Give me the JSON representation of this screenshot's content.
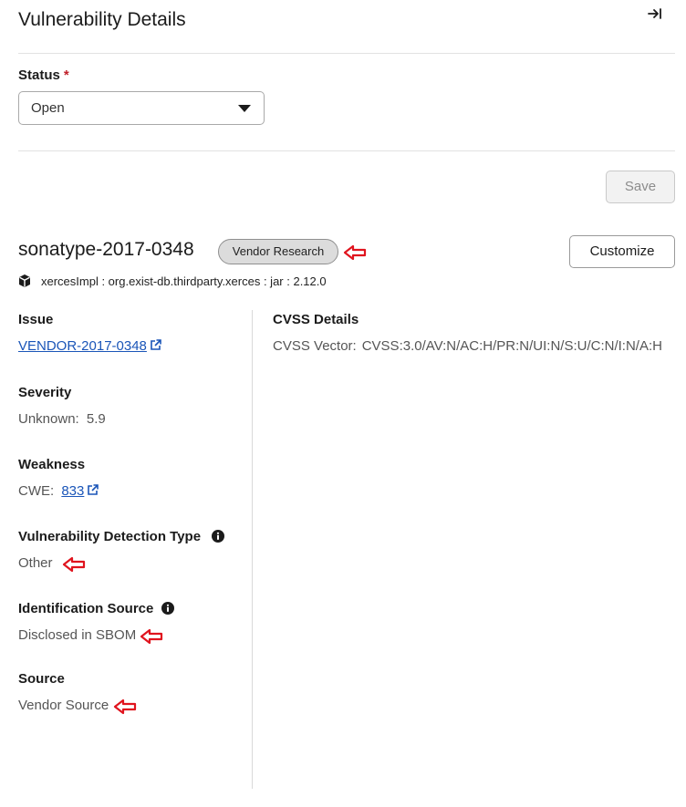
{
  "panel": {
    "title": "Vulnerability Details",
    "collapse_icon": "collapse-right-icon"
  },
  "status": {
    "label": "Status",
    "required_marker": "*",
    "selected": "Open"
  },
  "save_label": "Save",
  "vulnerability": {
    "id": "sonatype-2017-0348",
    "badge": "Vendor Research",
    "customize_label": "Customize",
    "component": "xercesImpl : org.exist-db.thirdparty.xerces : jar : 2.12.0"
  },
  "fields": {
    "issue": {
      "label": "Issue",
      "value": "VENDOR-2017-0348"
    },
    "severity": {
      "label": "Severity",
      "prefix": "Unknown:",
      "value": "5.9"
    },
    "weakness": {
      "label": "Weakness",
      "prefix": "CWE:",
      "value": "833"
    },
    "detection_type": {
      "label": "Vulnerability Detection Type",
      "value": "Other"
    },
    "identification_source": {
      "label": "Identification Source",
      "value": "Disclosed in SBOM"
    },
    "source": {
      "label": "Source",
      "value": "Vendor Source"
    }
  },
  "cvss": {
    "label": "CVSS Details",
    "vector_label": "CVSS Vector:",
    "vector_value": "CVSS:3.0/AV:N/AC:H/PR:N/UI:N/S:U/C:N/I:N/A:H"
  },
  "colors": {
    "accent_link": "#1a55b8",
    "annotation_arrow": "#e0141e",
    "required": "#c0202a"
  }
}
